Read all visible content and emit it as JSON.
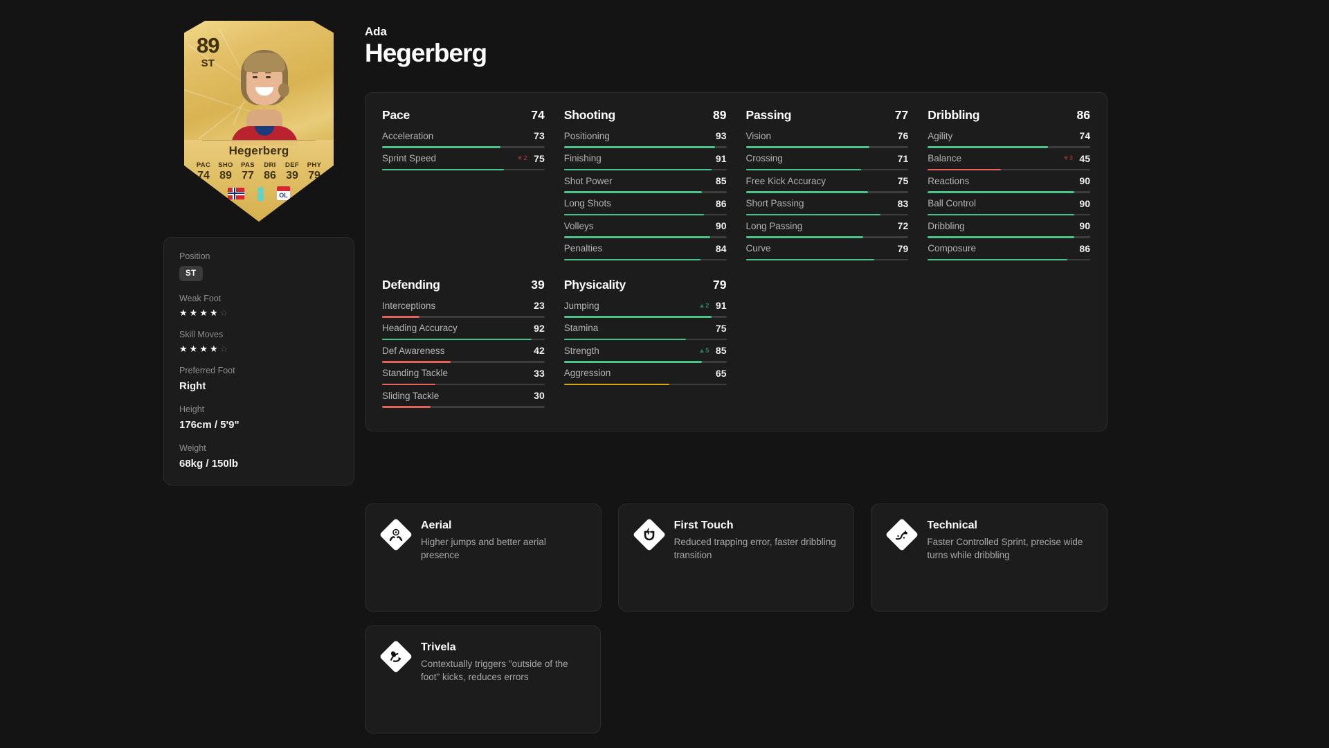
{
  "player": {
    "first_name": "Ada",
    "last_name": "Hegerberg",
    "card": {
      "rating": "89",
      "position": "ST",
      "name": "Hegerberg",
      "stats": [
        {
          "label": "PAC",
          "value": "74"
        },
        {
          "label": "SHO",
          "value": "89"
        },
        {
          "label": "PAS",
          "value": "77"
        },
        {
          "label": "DRI",
          "value": "86"
        },
        {
          "label": "DEF",
          "value": "39"
        },
        {
          "label": "PHY",
          "value": "79"
        }
      ],
      "nation_icon": "norway-flag-icon",
      "league_icon": "league-badge-icon",
      "club_icon": "olympique-lyonnais-crest-icon",
      "club_abbr": "OL"
    }
  },
  "info": {
    "position_label": "Position",
    "position_value": "ST",
    "weak_foot_label": "Weak Foot",
    "weak_foot": 4,
    "skill_moves_label": "Skill Moves",
    "skill_moves": 4,
    "preferred_foot_label": "Preferred Foot",
    "preferred_foot_value": "Right",
    "height_label": "Height",
    "height_value": "176cm / 5'9\"",
    "weight_label": "Weight",
    "weight_value": "68kg / 150lb",
    "star_total": 5
  },
  "colors": {
    "bar_high": "#4cc38a",
    "bar_mid": "#d6a518",
    "bar_low": "#e0635c",
    "mod_up": "#2e7d5b",
    "mod_down": "#8c3030",
    "page_bg": "#141414",
    "card_bg": "#1c1c1c"
  },
  "chart_data": {
    "type": "bar",
    "title": "Player Attribute Ratings",
    "ylim": [
      0,
      99
    ],
    "groups": [
      {
        "name": "Pace",
        "value": 74,
        "attributes": [
          {
            "name": "Acceleration",
            "value": 73,
            "modifier": null
          },
          {
            "name": "Sprint Speed",
            "value": 75,
            "modifier": -2
          }
        ]
      },
      {
        "name": "Shooting",
        "value": 89,
        "attributes": [
          {
            "name": "Positioning",
            "value": 93,
            "modifier": null
          },
          {
            "name": "Finishing",
            "value": 91,
            "modifier": null
          },
          {
            "name": "Shot Power",
            "value": 85,
            "modifier": null
          },
          {
            "name": "Long Shots",
            "value": 86,
            "modifier": null
          },
          {
            "name": "Volleys",
            "value": 90,
            "modifier": null
          },
          {
            "name": "Penalties",
            "value": 84,
            "modifier": null
          }
        ]
      },
      {
        "name": "Passing",
        "value": 77,
        "attributes": [
          {
            "name": "Vision",
            "value": 76,
            "modifier": null
          },
          {
            "name": "Crossing",
            "value": 71,
            "modifier": null
          },
          {
            "name": "Free Kick Accuracy",
            "value": 75,
            "modifier": null
          },
          {
            "name": "Short Passing",
            "value": 83,
            "modifier": null
          },
          {
            "name": "Long Passing",
            "value": 72,
            "modifier": null
          },
          {
            "name": "Curve",
            "value": 79,
            "modifier": null
          }
        ]
      },
      {
        "name": "Dribbling",
        "value": 86,
        "attributes": [
          {
            "name": "Agility",
            "value": 74,
            "modifier": null
          },
          {
            "name": "Balance",
            "value": 45,
            "modifier": -3
          },
          {
            "name": "Reactions",
            "value": 90,
            "modifier": null
          },
          {
            "name": "Ball Control",
            "value": 90,
            "modifier": null
          },
          {
            "name": "Dribbling",
            "value": 90,
            "modifier": null
          },
          {
            "name": "Composure",
            "value": 86,
            "modifier": null
          }
        ]
      },
      {
        "name": "Defending",
        "value": 39,
        "attributes": [
          {
            "name": "Interceptions",
            "value": 23,
            "modifier": null
          },
          {
            "name": "Heading Accuracy",
            "value": 92,
            "modifier": null
          },
          {
            "name": "Def Awareness",
            "value": 42,
            "modifier": null
          },
          {
            "name": "Standing Tackle",
            "value": 33,
            "modifier": null
          },
          {
            "name": "Sliding Tackle",
            "value": 30,
            "modifier": null
          }
        ]
      },
      {
        "name": "Physicality",
        "value": 79,
        "attributes": [
          {
            "name": "Jumping",
            "value": 91,
            "modifier": 2
          },
          {
            "name": "Stamina",
            "value": 75,
            "modifier": null
          },
          {
            "name": "Strength",
            "value": 85,
            "modifier": 5
          },
          {
            "name": "Aggression",
            "value": 65,
            "modifier": null
          }
        ]
      }
    ]
  },
  "playstyles": [
    {
      "name": "Aerial",
      "description": "Higher jumps and better aerial presence",
      "icon": "aerial-playstyle-icon"
    },
    {
      "name": "First Touch",
      "description": "Reduced trapping error, faster dribbling transition",
      "icon": "first-touch-playstyle-icon"
    },
    {
      "name": "Technical",
      "description": "Faster Controlled Sprint, precise wide turns while dribbling",
      "icon": "technical-playstyle-icon"
    },
    {
      "name": "Trivela",
      "description": "Contextually triggers \"outside of the foot\" kicks, reduces errors",
      "icon": "trivela-playstyle-icon"
    }
  ]
}
